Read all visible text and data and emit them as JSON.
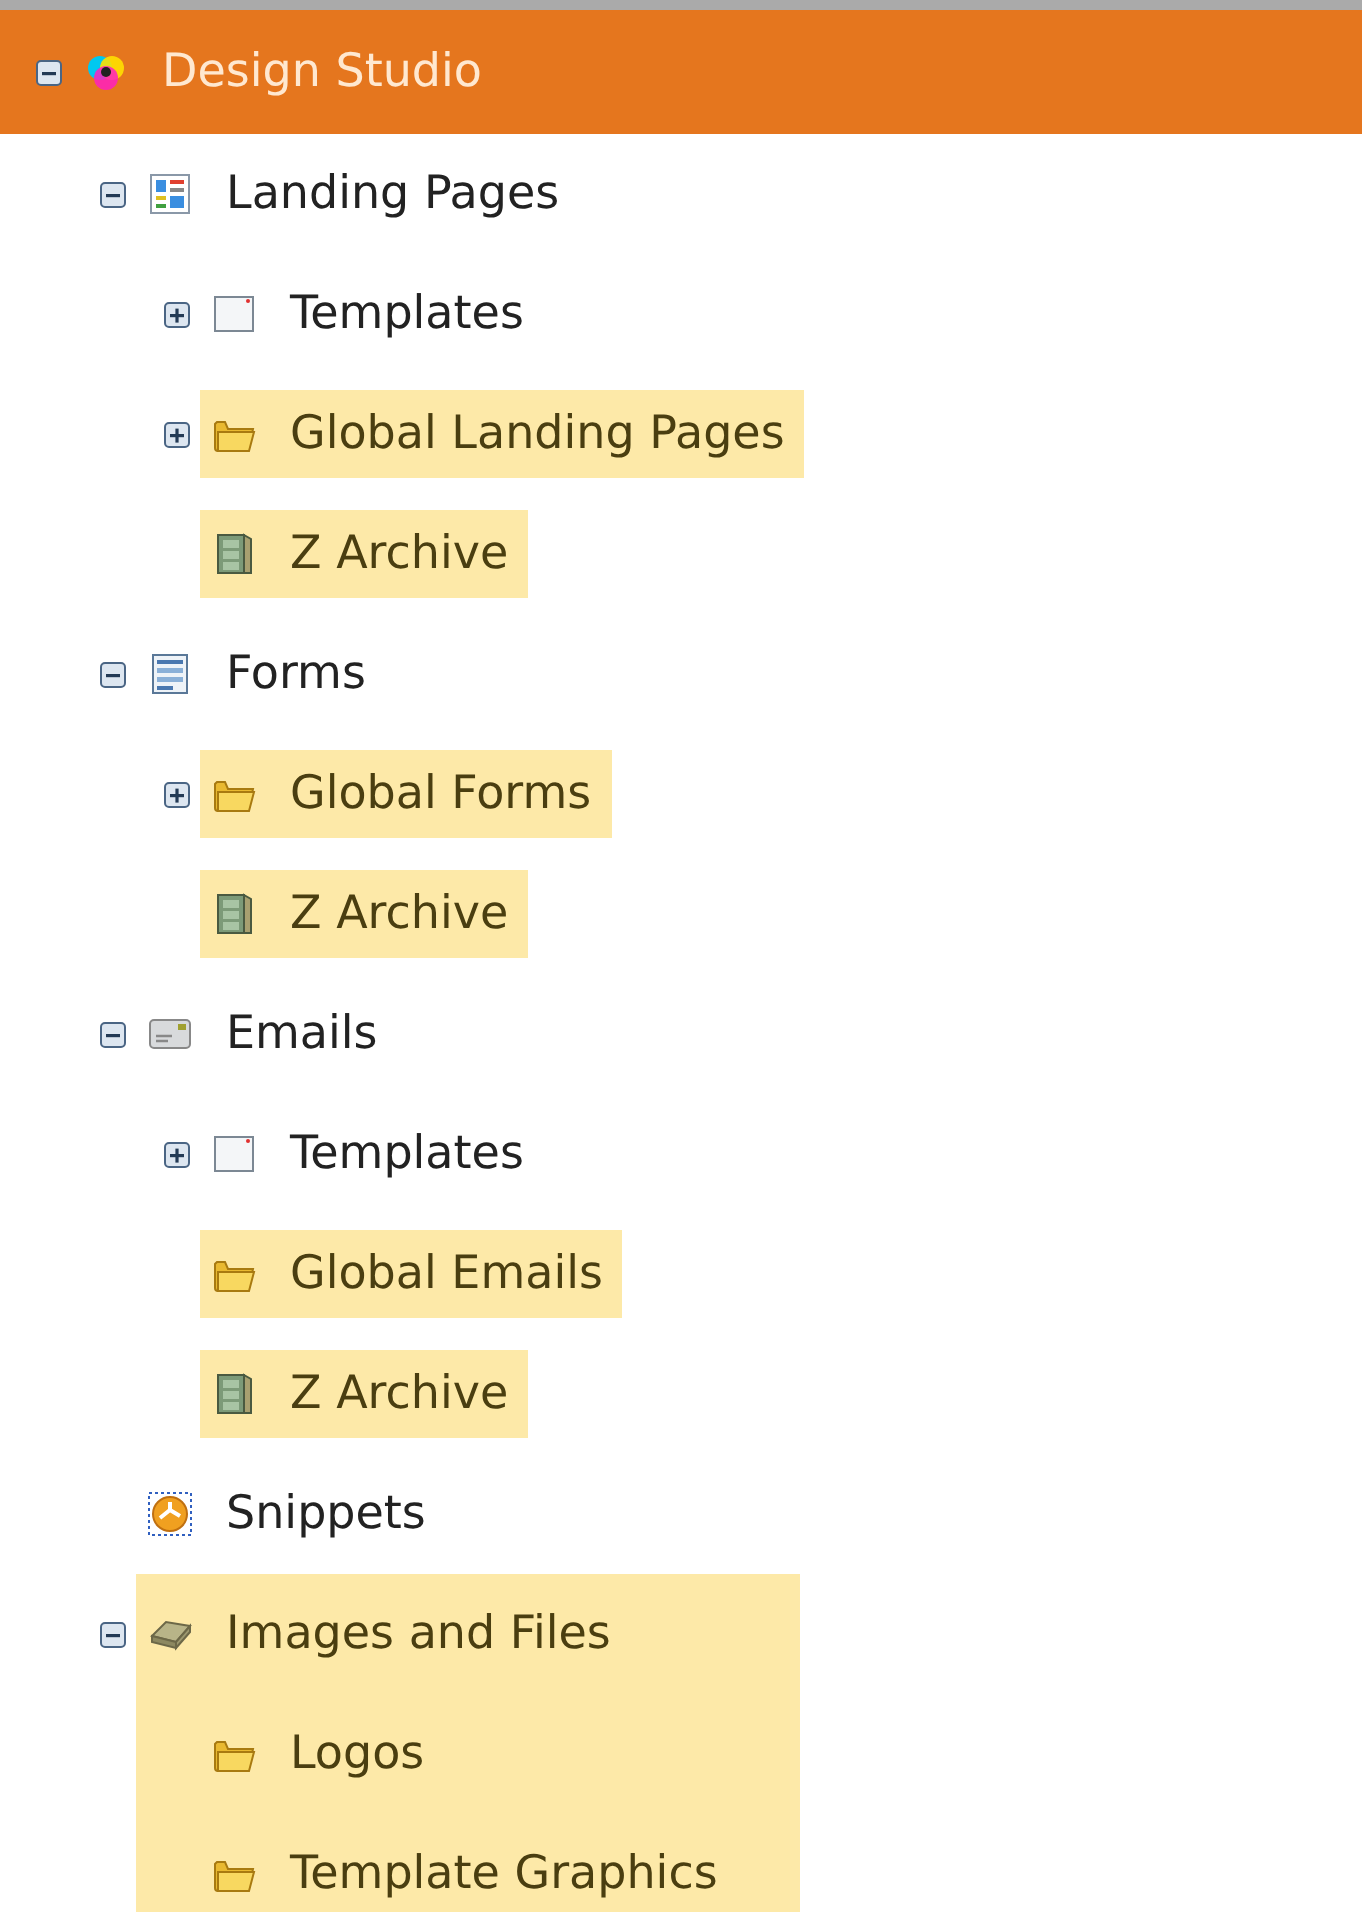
{
  "tree": {
    "label": "Design Studio",
    "kind": "studio",
    "expanded": true,
    "selected": true,
    "highlighted": false,
    "children": [
      {
        "label": "Landing Pages",
        "kind": "landing",
        "expanded": true,
        "selected": false,
        "highlighted": false,
        "children": [
          {
            "label": "Templates",
            "kind": "template",
            "expanded": false,
            "selected": false,
            "highlighted": false
          },
          {
            "label": "Global Landing Pages",
            "kind": "folder",
            "expanded": false,
            "selected": false,
            "highlighted": true
          },
          {
            "label": "Z Archive",
            "kind": "archive",
            "selected": false,
            "highlighted": true
          }
        ]
      },
      {
        "label": "Forms",
        "kind": "forms",
        "expanded": true,
        "selected": false,
        "highlighted": false,
        "children": [
          {
            "label": "Global Forms",
            "kind": "folder",
            "expanded": false,
            "selected": false,
            "highlighted": true
          },
          {
            "label": "Z Archive",
            "kind": "archive",
            "selected": false,
            "highlighted": true
          }
        ]
      },
      {
        "label": "Emails",
        "kind": "emails",
        "expanded": true,
        "selected": false,
        "highlighted": false,
        "children": [
          {
            "label": "Templates",
            "kind": "template",
            "expanded": false,
            "selected": false,
            "highlighted": false
          },
          {
            "label": "Global Emails",
            "kind": "folder",
            "selected": false,
            "highlighted": true
          },
          {
            "label": "Z Archive",
            "kind": "archive",
            "selected": false,
            "highlighted": true
          }
        ]
      },
      {
        "label": "Snippets",
        "kind": "snippets",
        "selected": false,
        "highlighted": false
      },
      {
        "label": "Images and Files",
        "kind": "images",
        "expanded": true,
        "selected": false,
        "highlighted": true,
        "children": [
          {
            "label": "Logos",
            "kind": "folder",
            "selected": false,
            "highlighted": true
          },
          {
            "label": "Template Graphics",
            "kind": "folder",
            "selected": false,
            "highlighted": true
          }
        ]
      }
    ]
  }
}
